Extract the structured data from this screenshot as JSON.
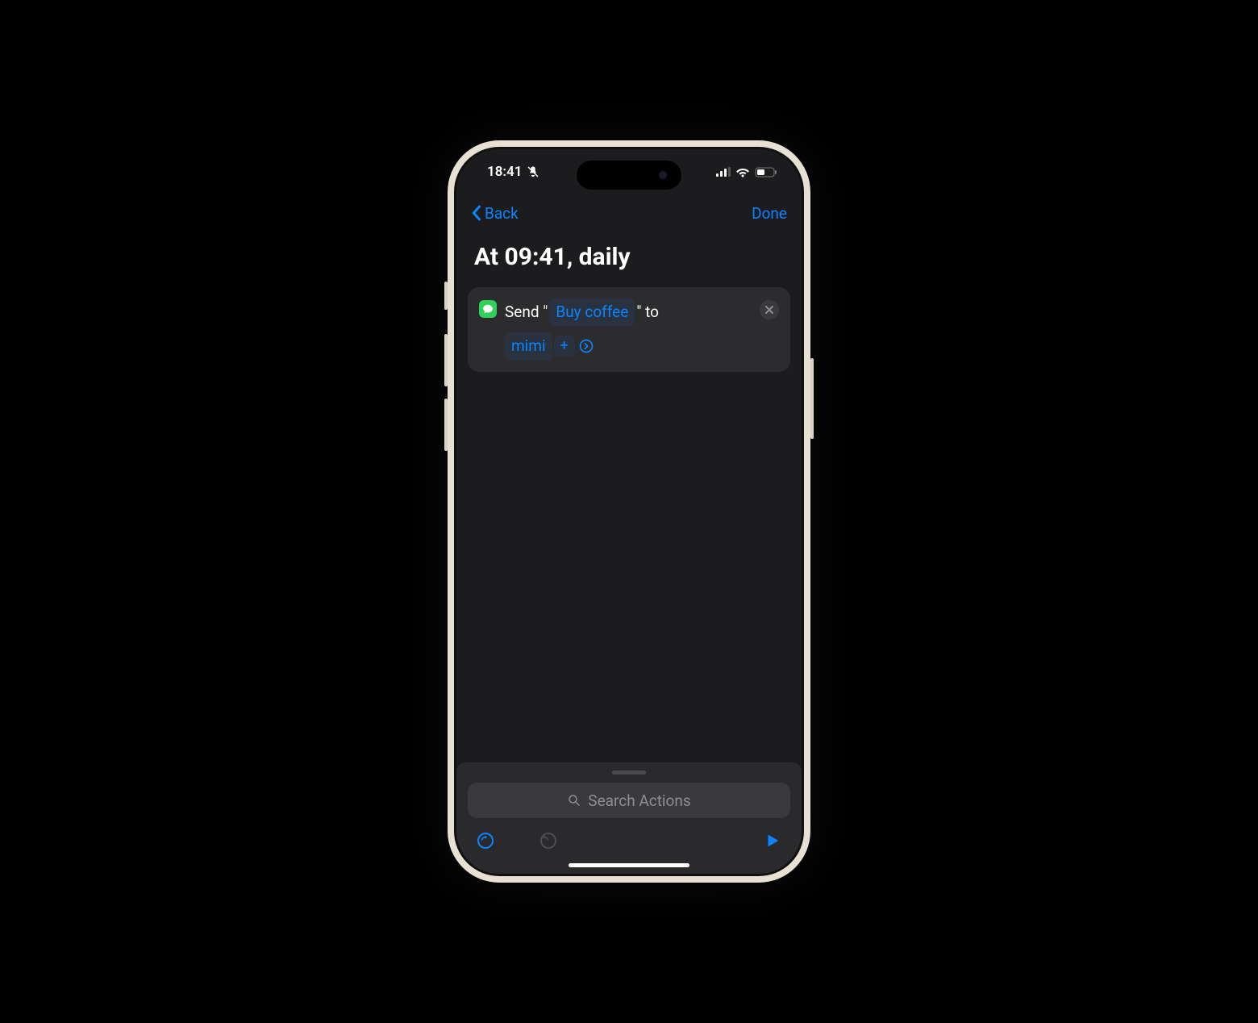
{
  "status": {
    "time": "18:41"
  },
  "nav": {
    "back_label": "Back",
    "done_label": "Done"
  },
  "title": "At 09:41, daily",
  "action": {
    "prefix": "Send \"",
    "message": "Buy coffee",
    "mid": "\" to",
    "recipient": "mimi",
    "plus": "+"
  },
  "search": {
    "placeholder": "Search Actions"
  }
}
